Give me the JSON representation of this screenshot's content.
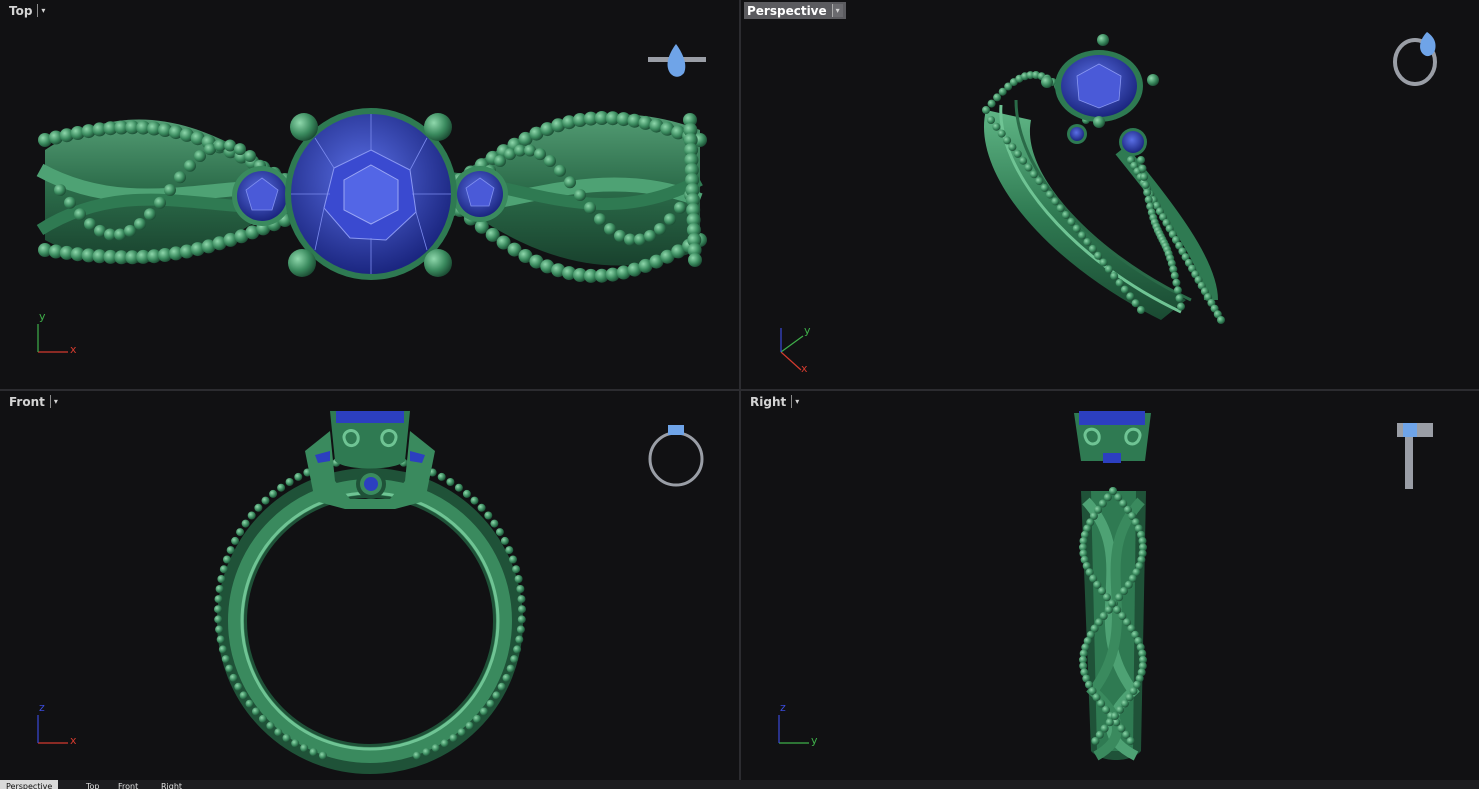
{
  "viewports": {
    "top": {
      "title": "Top"
    },
    "perspective": {
      "title": "Perspective"
    },
    "front": {
      "title": "Front"
    },
    "right": {
      "title": "Right"
    }
  },
  "axes": {
    "x": "x",
    "y": "y",
    "z": "z"
  },
  "tabs": [
    {
      "label": "Perspective",
      "active": true
    },
    {
      "label": "Top",
      "active": false
    },
    {
      "label": "Front",
      "active": false
    },
    {
      "label": "Right",
      "active": false
    }
  ],
  "colors": {
    "metal": "#3a8a5e",
    "metal_dark": "#1f5238",
    "metal_light": "#6fc494",
    "gem": "#2c3fc0",
    "gem_light": "#5a6fe6",
    "thumb_gem": "#6fa4e8",
    "thumb_metal": "#9a9ea6",
    "axis_x": "#d23a2e",
    "axis_y": "#3fb04a",
    "axis_z": "#3a4ad8",
    "active_title_bg": "#5b5b5f"
  }
}
